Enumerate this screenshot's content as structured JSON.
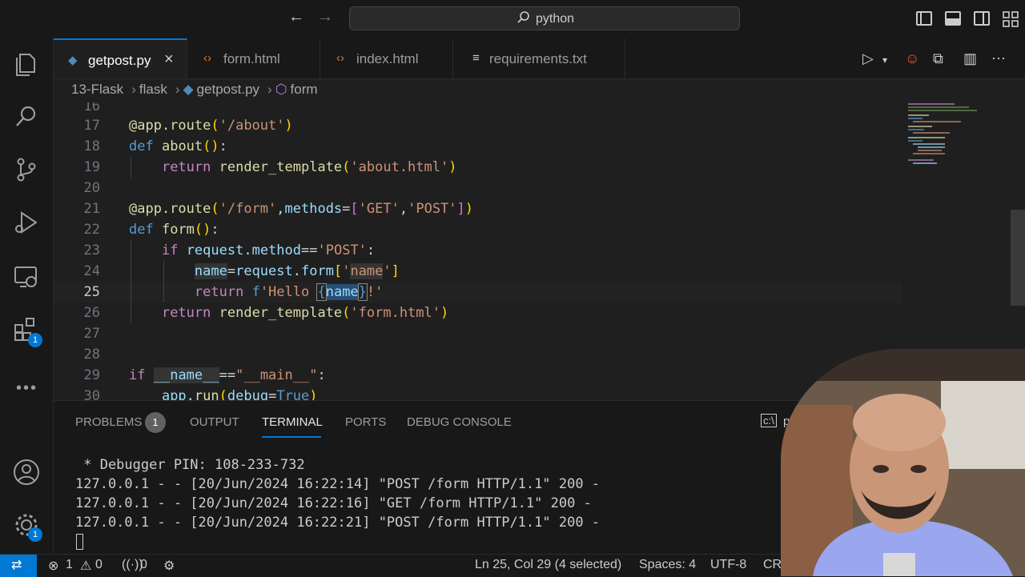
{
  "titlebar": {
    "search_text": "python"
  },
  "tabs": [
    {
      "label": "getpost.py",
      "type": "python",
      "active": true
    },
    {
      "label": "form.html",
      "type": "html",
      "active": false
    },
    {
      "label": "index.html",
      "type": "html",
      "active": false
    },
    {
      "label": "requirements.txt",
      "type": "text",
      "active": false
    }
  ],
  "tab_close": "×",
  "breadcrumb": {
    "folder1": "13-Flask",
    "folder2": "flask",
    "file": "getpost.py",
    "symbol": "form"
  },
  "editor": {
    "partial_top_line": "16",
    "lines": [
      {
        "n": "17"
      },
      {
        "n": "18"
      },
      {
        "n": "19"
      },
      {
        "n": "20"
      },
      {
        "n": "21"
      },
      {
        "n": "22"
      },
      {
        "n": "23"
      },
      {
        "n": "24"
      },
      {
        "n": "25"
      },
      {
        "n": "26"
      },
      {
        "n": "27"
      },
      {
        "n": "28"
      },
      {
        "n": "29"
      },
      {
        "n": "30"
      }
    ],
    "current_line": "25"
  },
  "panel": {
    "tabs": [
      "PROBLEMS",
      "OUTPUT",
      "TERMINAL",
      "PORTS",
      "DEBUG CONSOLE"
    ],
    "active_tab": "TERMINAL",
    "problems_count": "1",
    "terminal_shell": "py",
    "terminal_lines": [
      " * Debugger PIN: 108-233-732",
      "127.0.0.1 - - [20/Jun/2024 16:22:14] \"POST /form HTTP/1.1\" 200 -",
      "127.0.0.1 - - [20/Jun/2024 16:22:16] \"GET /form HTTP/1.1\" 200 -",
      "127.0.0.1 - - [20/Jun/2024 16:22:21] \"POST /form HTTP/1.1\" 200 -"
    ]
  },
  "activity": {
    "extensions_badge": "1",
    "settings_badge": "1"
  },
  "status": {
    "errors": "1",
    "warnings": "0",
    "ports": "0",
    "cursor_position": "Ln 25, Col 29 (4 selected)",
    "indent": "Spaces: 4",
    "encoding": "UTF-8",
    "eol": "CRLF"
  },
  "colors": {
    "accent": "#0078d4",
    "background": "#1f1f1f",
    "chrome": "#181818"
  }
}
